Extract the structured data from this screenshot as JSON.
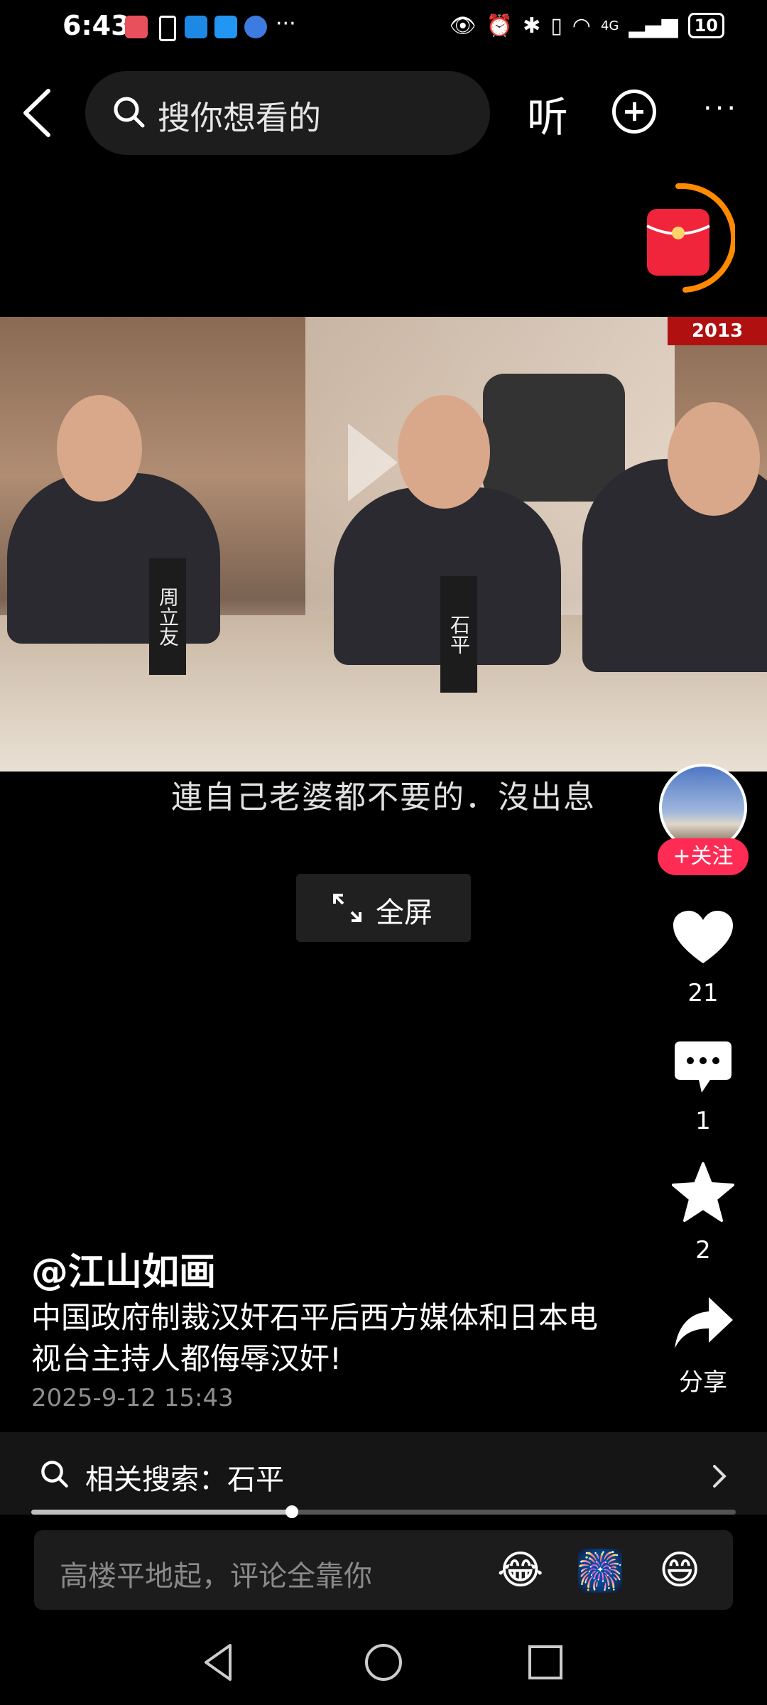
{
  "status": {
    "time": "6:43",
    "battery": "10",
    "network": "4G"
  },
  "topbar": {
    "search_placeholder": "搜你想看的",
    "listen_label": "听"
  },
  "video": {
    "banner": "2013",
    "nameplate_left": "周立友",
    "nameplate_center": "石平",
    "subtitle": "連自己老婆都不要的．沒出息"
  },
  "fullscreen_label": "全屏",
  "rail": {
    "follow_label": "+关注",
    "likes": "21",
    "comments": "1",
    "favorites": "2",
    "share_label": "分享"
  },
  "post": {
    "author": "@江山如画",
    "caption": "中国政府制裁汉奸石平后西方媒体和日本电视台主持人都侮辱汉奸!",
    "timestamp": "2025-9-12 15:43"
  },
  "related_search": {
    "label": "相关搜索：石平"
  },
  "playback": {
    "progress_fraction": 0.37
  },
  "comment_bar": {
    "placeholder": "高楼平地起，评论全靠你",
    "emojis": [
      "😂",
      "🎆",
      "😄"
    ]
  }
}
